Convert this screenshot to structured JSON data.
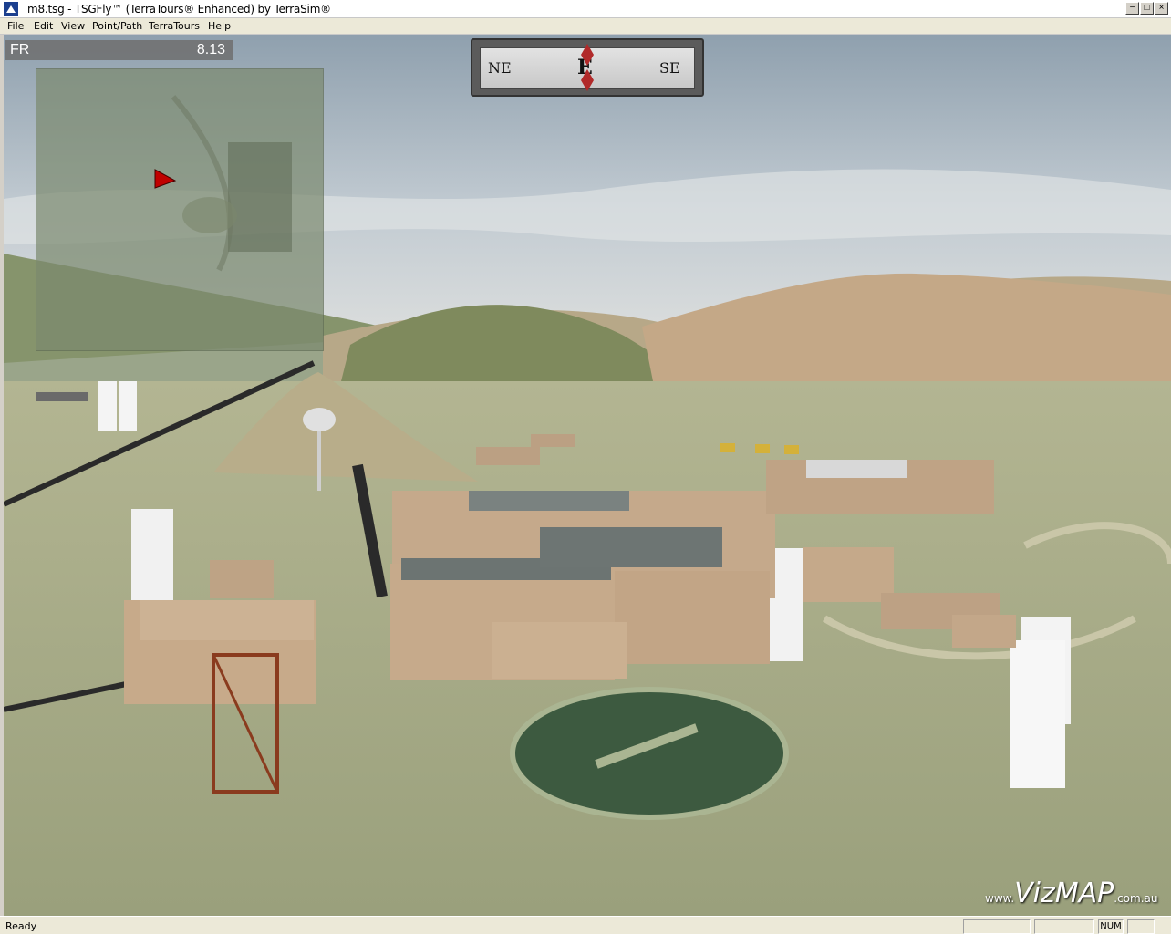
{
  "window": {
    "title": "m8.tsg - TSGFly™ (TerraTours® Enhanced) by TerraSim®",
    "minimize": "−",
    "restore": "□",
    "close": "×"
  },
  "menu": [
    "File",
    "Edit",
    "View",
    "Point/Path",
    "TerraTours",
    "Help"
  ],
  "hud": {
    "fr_label": "FR",
    "fr_value": "8.13"
  },
  "compass": {
    "left": "NE",
    "center": "E",
    "right": "SE"
  },
  "watermark": {
    "prefix": "www.",
    "brand": "VizMAP",
    "suffix": ".com.au"
  },
  "status": {
    "text": "Ready",
    "num": "NUM"
  },
  "icons": {
    "app": "tsgfly-app-icon",
    "minimap_cursor": "position-arrow-icon"
  },
  "colors": {
    "sky": "#aebcc6",
    "terrain": "#a8ad88",
    "building": "#c1a58a",
    "roof": "#6b7472",
    "cursor": "#c00000"
  }
}
